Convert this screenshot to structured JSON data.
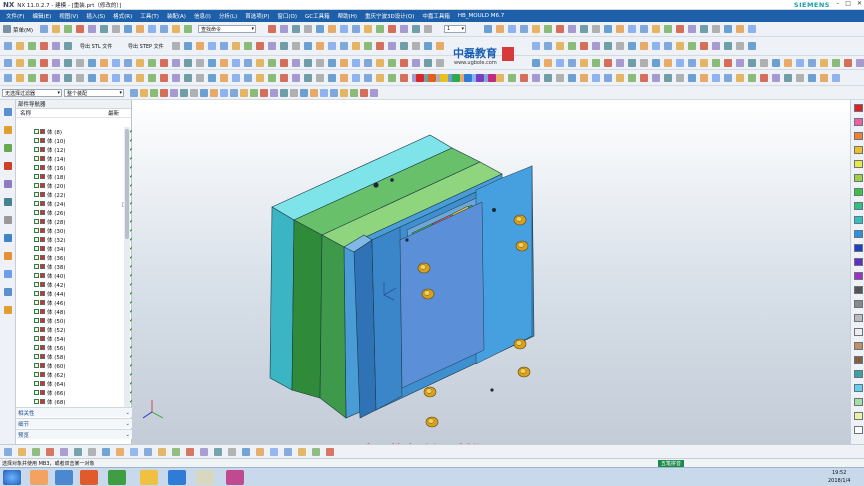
{
  "window": {
    "app_logo": "NX",
    "title": "NX 11.0.2.7 - 建模 - [重装.prt（修改的）]",
    "brand": "SIEMENS"
  },
  "menu": [
    "文件(F)",
    "编辑(E)",
    "视图(V)",
    "插入(S)",
    "格式(R)",
    "工具(T)",
    "装配(A)",
    "信息(I)",
    "分析(L)",
    "首选项(P)",
    "窗口(O)",
    "GC工具箱",
    "帮助(H)",
    "重庆宁波3D设计(Q)",
    "中嘉工具箱",
    "HB_MOULD M6.7"
  ],
  "toolbar": {
    "menu_label": "菜单(M)",
    "find_command_placeholder": "查找命令",
    "work_layer": "1",
    "export_stl": "导出 STL 文件",
    "export_step": "导出 STEP 文件"
  },
  "selection_bar": {
    "filter": "无选择过滤器",
    "scope": "整个装配"
  },
  "navigator": {
    "title": "部件导航器",
    "col_name": "名称",
    "col_latest": "最新",
    "rows": [
      "体 (8)",
      "体 (10)",
      "体 (12)",
      "体 (14)",
      "体 (16)",
      "体 (18)",
      "体 (20)",
      "体 (22)",
      "体 (24)",
      "体 (26)",
      "体 (28)",
      "体 (30)",
      "体 (32)",
      "体 (34)",
      "体 (36)",
      "体 (38)",
      "体 (40)",
      "体 (42)",
      "体 (44)",
      "体 (46)",
      "体 (48)",
      "体 (50)",
      "体 (52)",
      "体 (54)",
      "体 (56)",
      "体 (58)",
      "体 (60)",
      "体 (62)",
      "体 (64)",
      "体 (66)",
      "体 (68)"
    ],
    "sections": [
      "相关性",
      "细节",
      "预览"
    ]
  },
  "logo": {
    "cn": "中磊教育",
    "url": "www.ugbole.com"
  },
  "watermark": "中磊教育 刘磊 制作",
  "status": {
    "message": "选择对象并使用 MB3，或者双击某一对象"
  },
  "taskbar": {
    "app_label": "五笔拼音",
    "time": "19:52",
    "date": "2018/1/4"
  },
  "colors": {
    "menubar": "#1d5fa8",
    "mould_blue": "#3e8ed0",
    "mould_green": "#3c8f3c",
    "mould_cyan": "#3bb5c4",
    "watermark": "#c91515"
  }
}
